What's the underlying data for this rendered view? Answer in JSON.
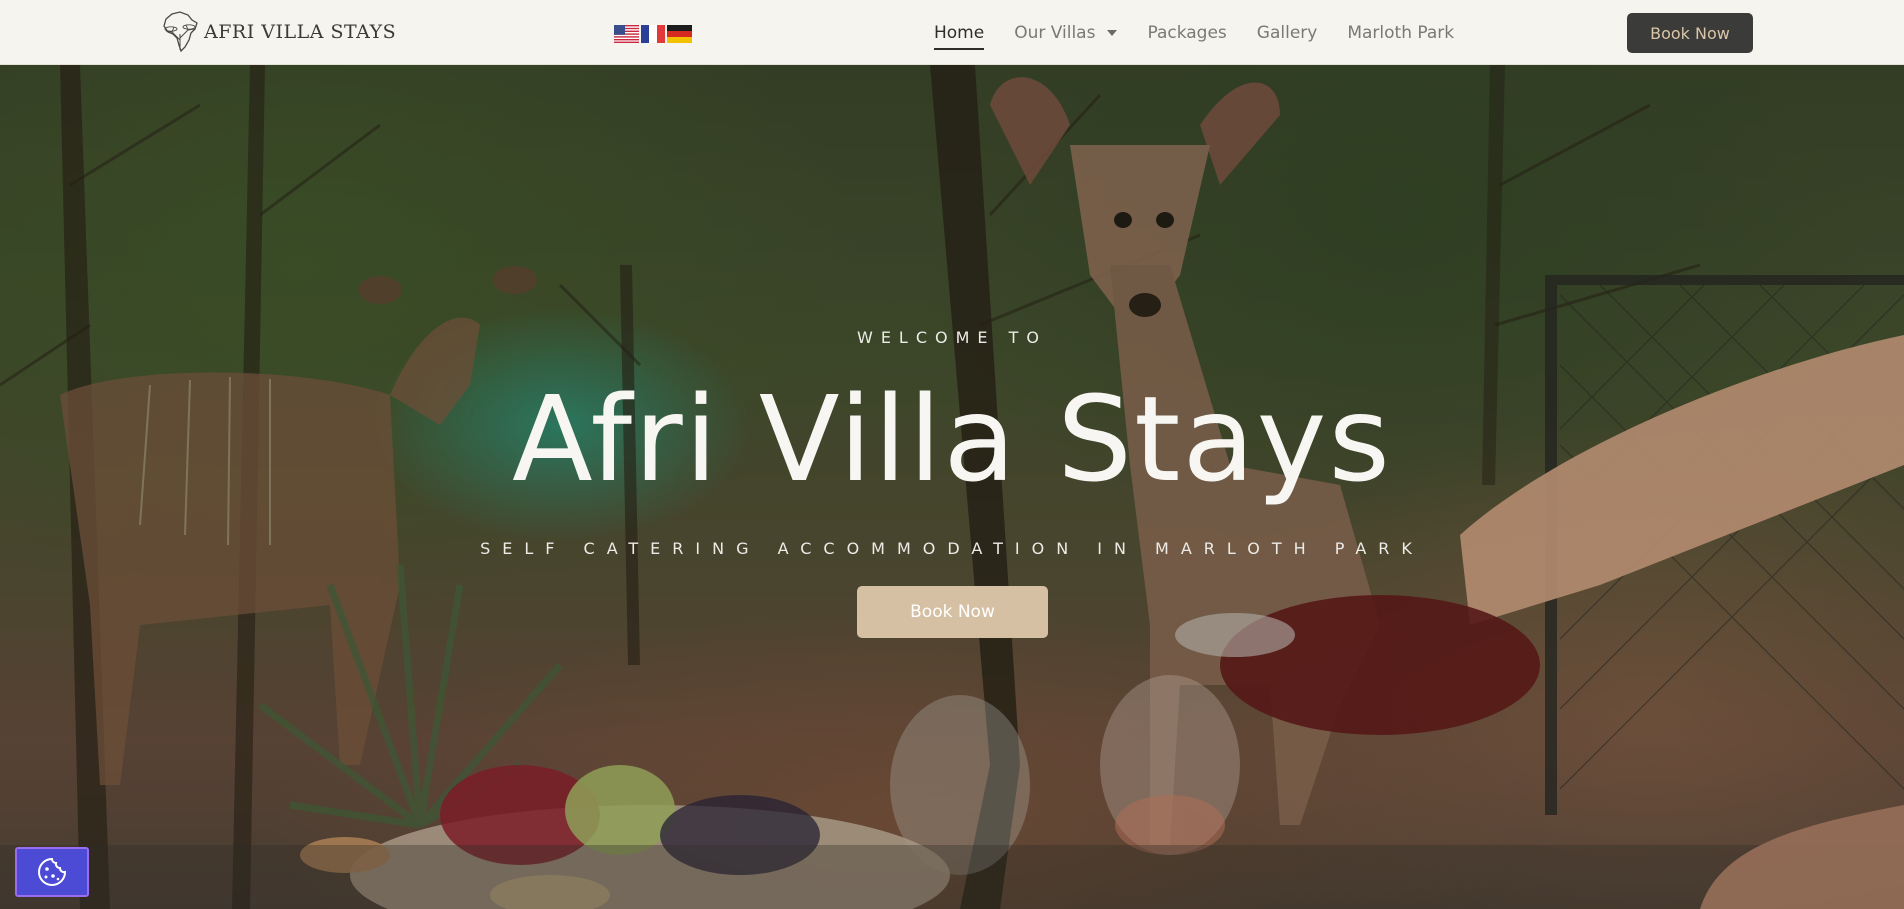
{
  "brand": {
    "name": "AFRI VILLA STAYS",
    "logo_icon": "africa-acacia-logo-icon"
  },
  "languages": [
    {
      "code": "en",
      "icon": "us-flag-icon"
    },
    {
      "code": "fr",
      "icon": "france-flag-icon"
    },
    {
      "code": "de",
      "icon": "germany-flag-icon"
    }
  ],
  "nav": {
    "items": [
      {
        "label": "Home",
        "active": true
      },
      {
        "label": "Our Villas",
        "has_dropdown": true
      },
      {
        "label": "Packages"
      },
      {
        "label": "Gallery"
      },
      {
        "label": "Marloth Park"
      }
    ],
    "book_label": "Book Now"
  },
  "hero": {
    "kicker": "WELCOME TO",
    "title": "Afri Villa Stays",
    "subtitle": "SELF CATERING ACCOMMODATION IN MARLOTH PARK",
    "cta_label": "Book Now"
  },
  "cookie_button": {
    "icon": "cookie-icon"
  },
  "colors": {
    "header_bg": "#f5f4ef",
    "header_button_bg": "#3b3b39",
    "header_button_text": "#d9c6a8",
    "hero_button_bg": "#d5c0a4",
    "cookie_bg": "#4b4bd6"
  }
}
